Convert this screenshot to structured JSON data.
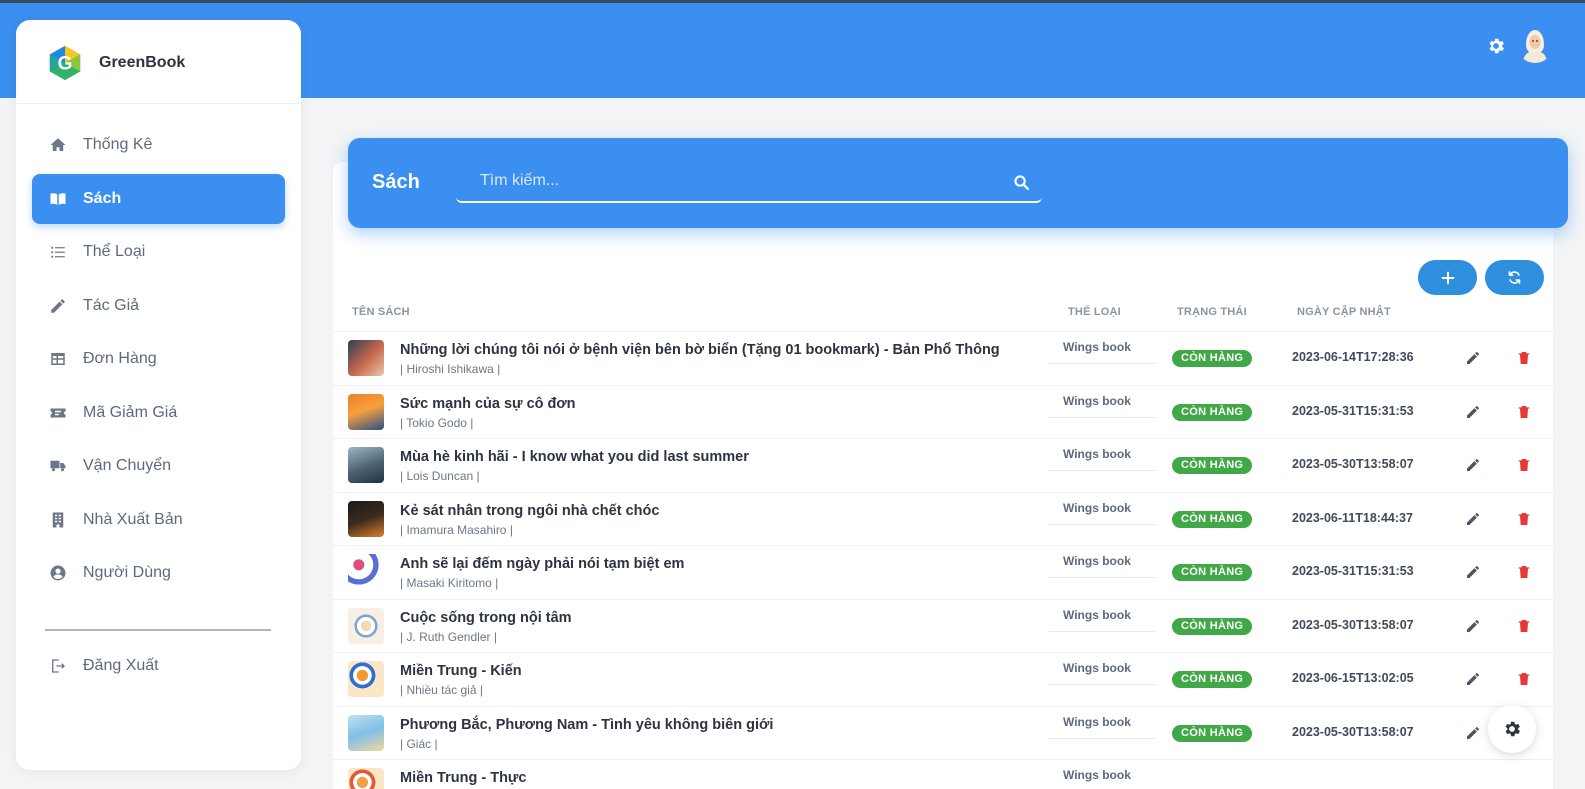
{
  "brand": {
    "name": "GreenBook"
  },
  "sidebar": {
    "items": [
      {
        "label": "Thống Kê",
        "icon": "home-icon",
        "active": false
      },
      {
        "label": "Sách",
        "icon": "book-open-icon",
        "active": true
      },
      {
        "label": "Thể Loại",
        "icon": "list-icon",
        "active": false
      },
      {
        "label": "Tác Giả",
        "icon": "pencil-icon",
        "active": false
      },
      {
        "label": "Đơn Hàng",
        "icon": "table-icon",
        "active": false
      },
      {
        "label": "Mã Giảm Giá",
        "icon": "ticket-icon",
        "active": false
      },
      {
        "label": "Vận Chuyển",
        "icon": "truck-icon",
        "active": false
      },
      {
        "label": "Nhà Xuất Bản",
        "icon": "building-icon",
        "active": false
      },
      {
        "label": "Người Dùng",
        "icon": "user-circle-icon",
        "active": false
      }
    ],
    "logout_label": "Đăng Xuất"
  },
  "header": {
    "title": "Sách",
    "search_placeholder": "Tìm kiếm..."
  },
  "table": {
    "columns": {
      "name": "TÊN SÁCH",
      "category": "THỂ LOẠI",
      "status": "TRẠNG THÁI",
      "updated": "NGÀY CẬP NHẬT"
    },
    "rows": [
      {
        "title": "Những lời chúng tôi nói ở bệnh viện bên bờ biển (Tặng 01 bookmark) - Bản Phổ Thông",
        "author": "| Hiroshi Ishikawa |",
        "category": "Wings book",
        "status": "CÒN HÀNG",
        "updated": "2023-06-14T17:28:36"
      },
      {
        "title": "Sức mạnh của sự cô đơn",
        "author": "| Tokio Godo |",
        "category": "Wings book",
        "status": "CÒN HÀNG",
        "updated": "2023-05-31T15:31:53"
      },
      {
        "title": "Mùa hè kinh hãi - I know what you did last summer",
        "author": "| Lois Duncan |",
        "category": "Wings book",
        "status": "CÒN HÀNG",
        "updated": "2023-05-30T13:58:07"
      },
      {
        "title": "Kẻ sát nhân trong ngôi nhà chết chóc",
        "author": "| Imamura Masahiro |",
        "category": "Wings book",
        "status": "CÒN HÀNG",
        "updated": "2023-06-11T18:44:37"
      },
      {
        "title": "Anh sẽ lại đếm ngày phải nói tạm biệt em",
        "author": "| Masaki Kiritomo |",
        "category": "Wings book",
        "status": "CÒN HÀNG",
        "updated": "2023-05-31T15:31:53"
      },
      {
        "title": "Cuộc sống trong nội tâm",
        "author": "| J. Ruth Gendler |",
        "category": "Wings book",
        "status": "CÒN HÀNG",
        "updated": "2023-05-30T13:58:07"
      },
      {
        "title": "Miền Trung - Kiến",
        "author": "| Nhiều tác giả |",
        "category": "Wings book",
        "status": "CÒN HÀNG",
        "updated": "2023-06-15T13:02:05"
      },
      {
        "title": "Phương Bắc, Phương Nam - Tình yêu không biên giới",
        "author": "| Giác |",
        "category": "Wings book",
        "status": "CÒN HÀNG",
        "updated": "2023-05-30T13:58:07"
      },
      {
        "title": "Miền Trung - Thực",
        "author": "",
        "category": "Wings book",
        "status": "",
        "updated": ""
      }
    ]
  },
  "colors": {
    "primary": "#3b8ff0",
    "status_green": "#41a848",
    "delete_red": "#e53935"
  }
}
